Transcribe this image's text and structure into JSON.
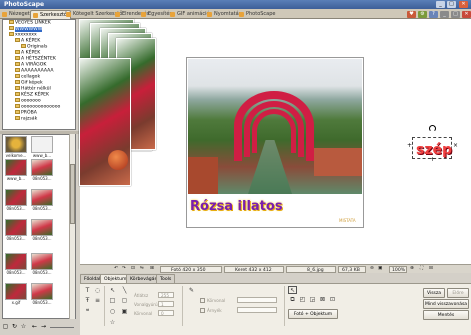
{
  "window": {
    "title": "PhotoScape",
    "controls": [
      "_",
      "□",
      "✕"
    ]
  },
  "tabs": [
    {
      "label": "Nézegető",
      "active": false
    },
    {
      "label": "Szerkesztő",
      "active": true
    },
    {
      "label": "Kötegelt Szerkesztő",
      "active": false
    },
    {
      "label": "Elrendezés",
      "active": false
    },
    {
      "label": "Egyesítés",
      "active": false
    },
    {
      "label": "GIF animáció",
      "active": false
    },
    {
      "label": "Nyomtatás",
      "active": false
    },
    {
      "label": "PhotoScape",
      "active": false
    }
  ],
  "folder_tree": [
    {
      "label": "VEGYES LINKEK",
      "indent": 1,
      "selected": false
    },
    {
      "label": "WWWWWW",
      "indent": 1,
      "selected": true
    },
    {
      "label": "xxxxxxxx",
      "indent": 1,
      "selected": false
    },
    {
      "label": "A KÉPEK",
      "indent": 2,
      "selected": false
    },
    {
      "label": "Originals",
      "indent": 3,
      "selected": false
    },
    {
      "label": "A KÉPEK",
      "indent": 2,
      "selected": false
    },
    {
      "label": "A HÉTSZÉNTEK",
      "indent": 2,
      "selected": false
    },
    {
      "label": "A VIRÁGOK",
      "indent": 2,
      "selected": false
    },
    {
      "label": "AAAAAAAAAA",
      "indent": 2,
      "selected": false
    },
    {
      "label": "cellagok",
      "indent": 2,
      "selected": false
    },
    {
      "label": "Gif képek",
      "indent": 2,
      "selected": false
    },
    {
      "label": "Háttér nélkül",
      "indent": 2,
      "selected": false
    },
    {
      "label": "KÉSZ KÉPEK",
      "indent": 2,
      "selected": false
    },
    {
      "label": "ooooooo",
      "indent": 2,
      "selected": false
    },
    {
      "label": "oooooooooooooo",
      "indent": 2,
      "selected": false
    },
    {
      "label": "PRÓBA",
      "indent": 2,
      "selected": false
    },
    {
      "label": "rajzsák",
      "indent": 2,
      "selected": false
    }
  ],
  "thumbnails": [
    {
      "caption": "velkome...",
      "kind": "gift"
    },
    {
      "caption": "www_b...",
      "kind": "blank"
    },
    {
      "caption": "www_b...",
      "kind": "photo"
    },
    {
      "caption": "08n053...",
      "kind": "alt"
    },
    {
      "caption": "08n053...",
      "kind": "photo"
    },
    {
      "caption": "08n053...",
      "kind": "alt"
    },
    {
      "caption": "08n053...",
      "kind": "photo"
    },
    {
      "caption": "08n053...",
      "kind": "alt"
    },
    {
      "caption": "08n053...",
      "kind": "photo"
    },
    {
      "caption": "08n053...",
      "kind": "alt"
    },
    {
      "caption": "x.gif",
      "kind": "photo"
    },
    {
      "caption": "08n053...",
      "kind": "alt"
    }
  ],
  "canvas": {
    "main_text": "Rózsa illatos",
    "watermark": "MISTATA",
    "object_text": "szép"
  },
  "statusbar": {
    "photo_size": "Fotó 420 x 350",
    "frame_size": "Keret 432 x 412",
    "filename": "8_6.jpg",
    "filesize": "67,3 KB",
    "zoom": "100%"
  },
  "bottom_tabs": [
    {
      "label": "Főoldal",
      "active": false
    },
    {
      "label": "Objektum",
      "active": true
    },
    {
      "label": "Körbevágás",
      "active": false
    },
    {
      "label": "Tools",
      "active": false
    }
  ],
  "object_panel": {
    "fields": [
      "Átlátsz",
      "Vonalgyúrú",
      "Körvonal"
    ],
    "values": [
      "255",
      "1",
      "0"
    ],
    "checks": [
      "Körvonal",
      "Árnyék"
    ],
    "photo_object_button": "Fotó + Objektum"
  },
  "actions": {
    "restore": "Vissza",
    "redo": "Előre",
    "restore_all": "Mind visszavonása",
    "save": "Mentés"
  },
  "colors": {
    "titlebar": "#3d5f98",
    "accent_tab": "#e8a33a",
    "text_main": "#7a1fae",
    "object_text": "#f04040",
    "selection": "#3169c6"
  }
}
